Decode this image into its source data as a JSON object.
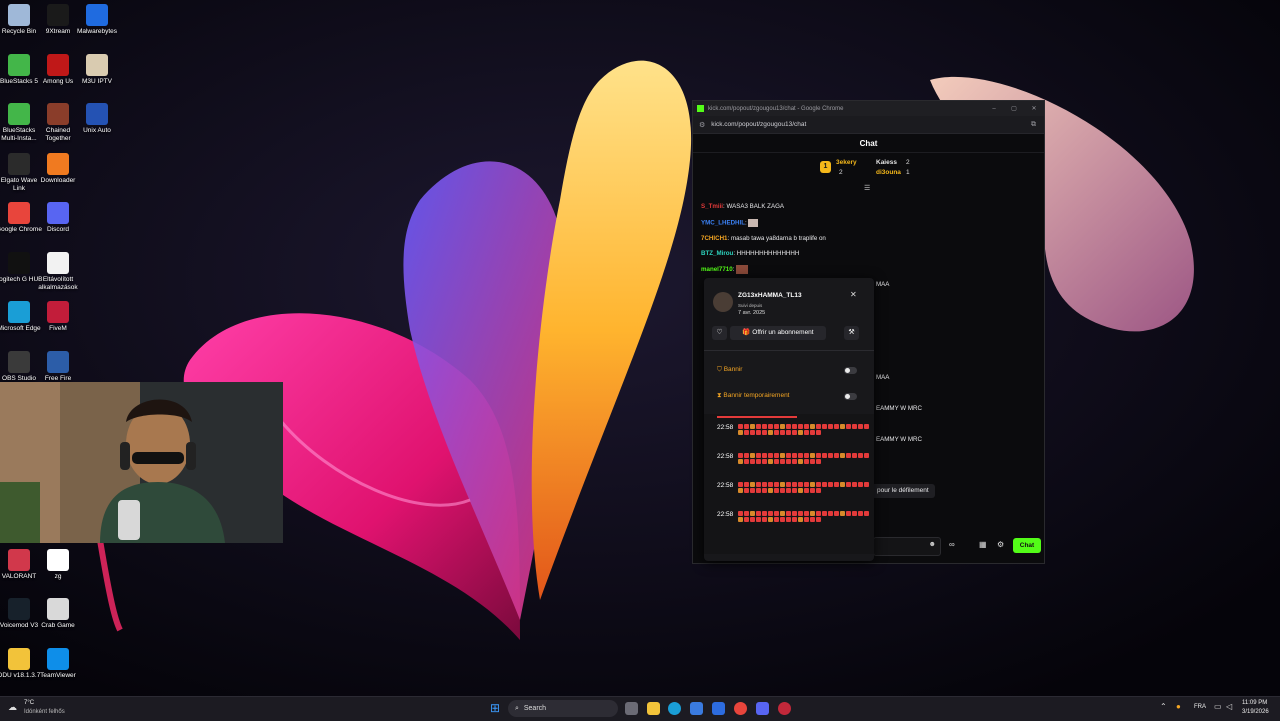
{
  "desktop": {
    "icons": [
      {
        "label": "Recycle Bin",
        "icon": "recycle-bin-icon",
        "color": "#9fb8d8"
      },
      {
        "label": "9Xtream",
        "icon": "9xtream-icon",
        "color": "#1a1a1a"
      },
      {
        "label": "Malwarebytes",
        "icon": "malwarebytes-icon",
        "color": "#1f6be0"
      },
      {
        "label": "BlueStacks 5",
        "icon": "bluestacks-icon",
        "color": "#43b649"
      },
      {
        "label": "Among Us",
        "icon": "among-us-icon",
        "color": "#c01818"
      },
      {
        "label": "M3U IPTV",
        "icon": "m3u-iptv-icon",
        "color": "#d9cbb0"
      },
      {
        "label": "BlueStacks Multi-Insta...",
        "icon": "bluestacks-multi-icon",
        "color": "#43b649"
      },
      {
        "label": "Chained Together",
        "icon": "chained-together-icon",
        "color": "#8a3d2a"
      },
      {
        "label": "Unix Auto",
        "icon": "unix-auto-icon",
        "color": "#2452b3"
      },
      {
        "label": "Elgato Wave Link",
        "icon": "elgato-wave-icon",
        "color": "#2b2b2b"
      },
      {
        "label": "Downloader",
        "icon": "downloader-icon",
        "color": "#f07a20"
      },
      {
        "label": "Google Chrome",
        "icon": "chrome-icon",
        "color": "#e8453c"
      },
      {
        "label": "Discord",
        "icon": "discord-icon",
        "color": "#5865f2"
      },
      {
        "label": "Logitech G HUB",
        "icon": "logitech-icon",
        "color": "#111111"
      },
      {
        "label": "Eltávolított alkalmazások",
        "icon": "removed-apps-icon",
        "color": "#f2f2f2"
      },
      {
        "label": "Microsoft Edge",
        "icon": "edge-icon",
        "color": "#1a9ed6"
      },
      {
        "label": "FiveM",
        "icon": "fivem-icon",
        "color": "#c21d3a"
      },
      {
        "label": "OBS Studio",
        "icon": "obs-icon",
        "color": "#3a3a3a"
      },
      {
        "label": "Free Fire",
        "icon": "free-fire-icon",
        "color": "#2c5da8"
      },
      {
        "label": "VALORANT",
        "icon": "valorant-icon",
        "color": "#d1384b"
      },
      {
        "label": "zg",
        "icon": "file-icon",
        "color": "#ffffff"
      },
      {
        "label": "Voicemod V3",
        "icon": "voicemod-icon",
        "color": "#17212b"
      },
      {
        "label": "Crab Game",
        "icon": "crab-game-icon",
        "color": "#d9d9d9"
      },
      {
        "label": "DDU v18.1.3.7",
        "icon": "folder-icon",
        "color": "#f2c33a"
      },
      {
        "label": "TeamViewer",
        "icon": "teamviewer-icon",
        "color": "#0e8ee9"
      }
    ]
  },
  "chrome": {
    "title": "kick.com/popout/zgougou13/chat - Google Chrome",
    "url": "kick.com/popout/zgougou13/chat",
    "header": "Chat"
  },
  "leaderboard": {
    "first": {
      "name": "3ekery",
      "count": "2"
    },
    "second": {
      "name": "Kaiess",
      "count": "2"
    },
    "third": {
      "name": "di3ouna",
      "count": "1"
    },
    "rank_badge": "1"
  },
  "chat": {
    "messages": [
      {
        "user": "S_Tmiii",
        "text": "WASA3 BALK ZAGA",
        "color": "#e23a3a"
      },
      {
        "user": "YMC_LHEDHIL",
        "text": "",
        "color": "#3b82f6"
      },
      {
        "user": "7CHICH1",
        "text": "masab tawa ya8darna b traplife on",
        "color": "#f5a623"
      },
      {
        "user": "BTZ_Mirou",
        "text": "HHHHHHHHHHHHHH",
        "color": "#2dd4bf"
      },
      {
        "user": "manel7710",
        "text": "",
        "color": "#53fc18"
      }
    ],
    "side_fragments": [
      "MAA",
      "MAA",
      "EAMMY W MRC",
      "EAMMY W MRC"
    ],
    "scroll_pause": "pour le défilement",
    "send_button": "Chat",
    "accent": "#53fc18"
  },
  "user_card": {
    "username": "ZG13xHAMMA_TL13",
    "followed_label": "Suivi depuis",
    "followed_date": "7 avr. 2025",
    "subscribe_gift": "Offrir un abonnement",
    "ban_label": "Bannir",
    "timeout_label": "Bannir temporairement",
    "message_times": [
      "22:58",
      "22:58",
      "22:58",
      "22:58"
    ]
  },
  "taskbar": {
    "weather_temp": "7°C",
    "weather_desc": "Idónként felhős",
    "search_placeholder": "Search",
    "language": "FRA",
    "time": "11:09 PM",
    "date": "3/19/2026"
  }
}
